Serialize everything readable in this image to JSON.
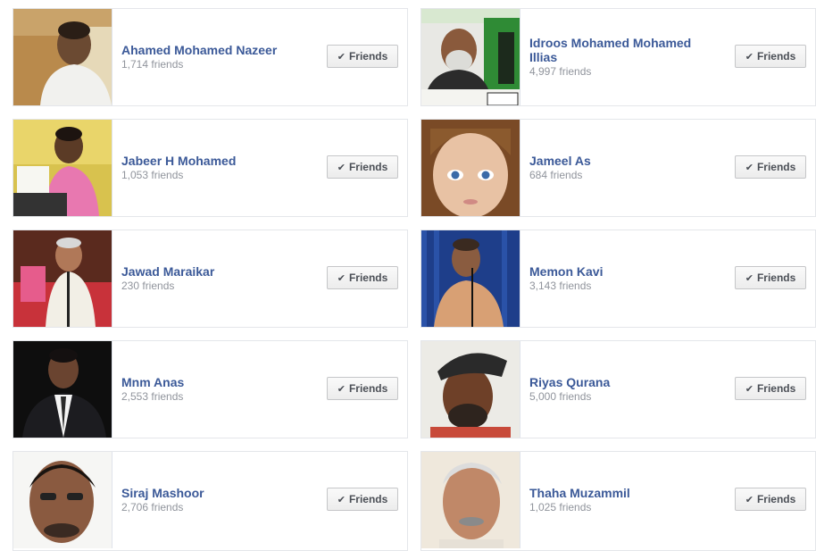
{
  "button_label": "Friends",
  "check_icon": "✔",
  "friends": [
    {
      "name": "Ahamed Mohamed Nazeer",
      "count": "1,714 friends"
    },
    {
      "name": "Idroos Mohamed Mohamed Illias",
      "count": "4,997 friends"
    },
    {
      "name": "Jabeer H Mohamed",
      "count": "1,053 friends"
    },
    {
      "name": "Jameel As",
      "count": "684 friends"
    },
    {
      "name": "Jawad Maraikar",
      "count": "230 friends"
    },
    {
      "name": "Memon Kavi",
      "count": "3,143 friends"
    },
    {
      "name": "Mnm Anas",
      "count": "2,553 friends"
    },
    {
      "name": "Riyas Qurana",
      "count": "5,000 friends"
    },
    {
      "name": "Siraj Mashoor",
      "count": "2,706 friends"
    },
    {
      "name": "Thaha Muzammil",
      "count": "1,025 friends"
    }
  ]
}
